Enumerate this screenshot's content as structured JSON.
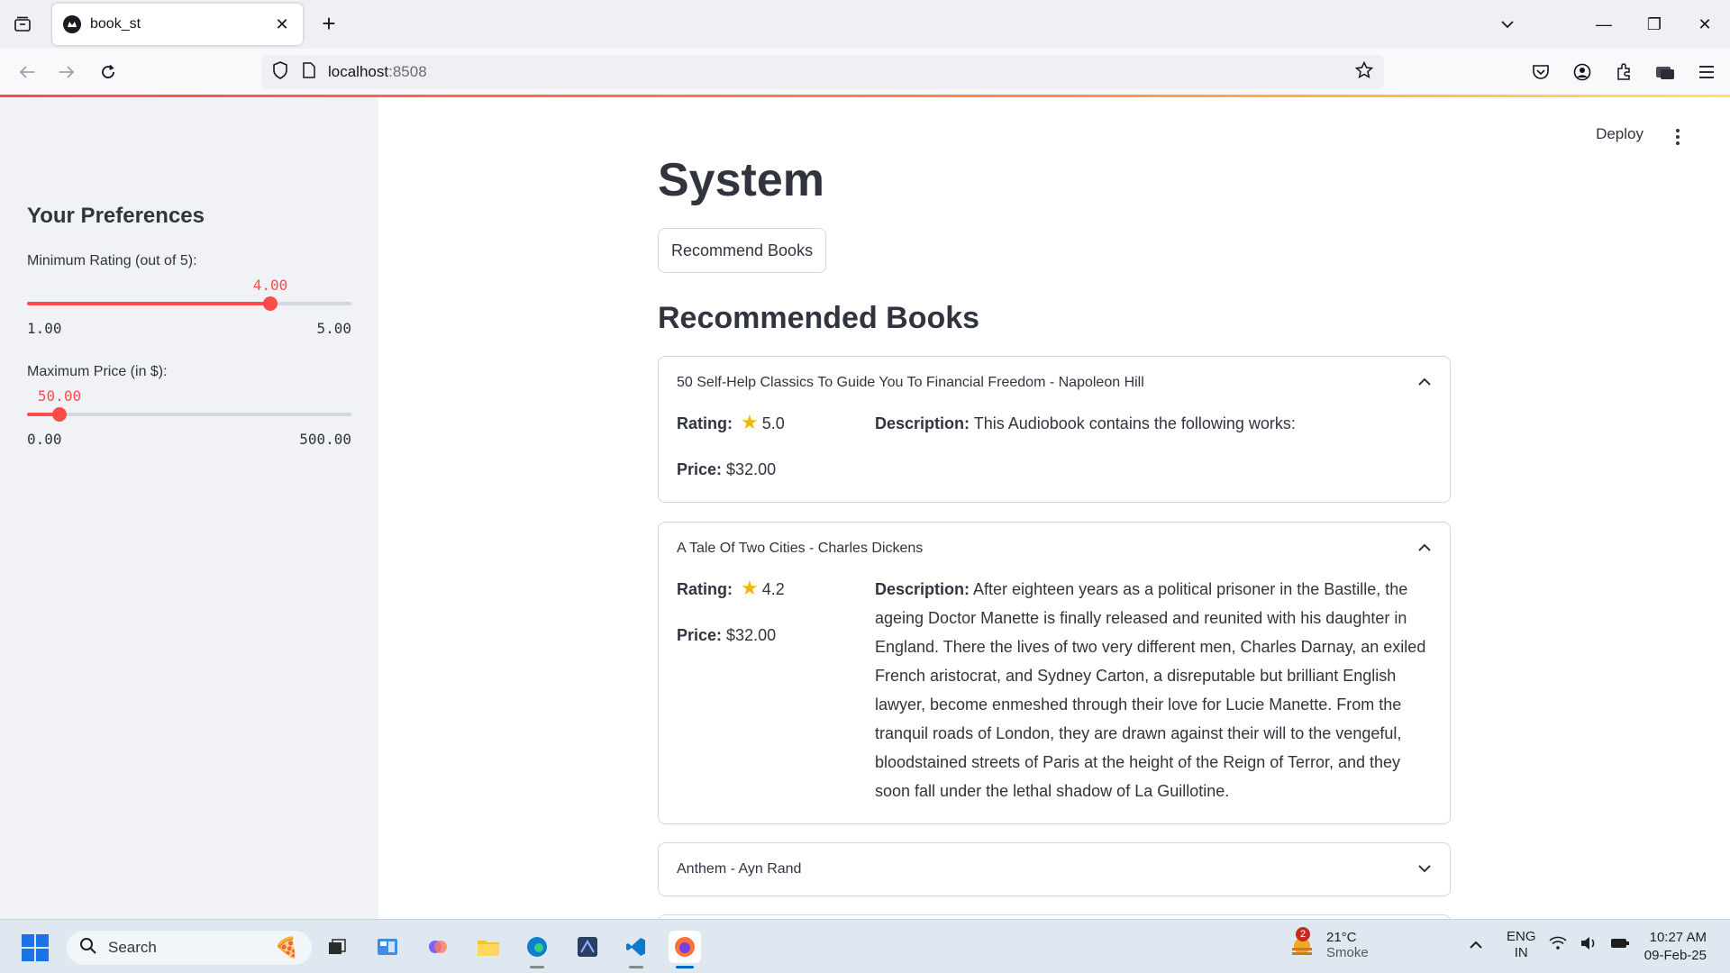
{
  "browser": {
    "tab_title": "book_st",
    "url_host": "localhost",
    "url_port": ":8508"
  },
  "app": {
    "deploy_label": "Deploy",
    "page_title": "System",
    "recommend_button": "Recommend Books",
    "section_title": "Recommended Books"
  },
  "sidebar": {
    "heading": "Your Preferences",
    "rating_slider": {
      "label": "Minimum Rating (out of 5):",
      "value": "4.00",
      "min": "1.00",
      "max": "5.00",
      "value_num": 4.0,
      "min_num": 1.0,
      "max_num": 5.0
    },
    "price_slider": {
      "label": "Maximum Price (in $):",
      "value": "50.00",
      "min": "0.00",
      "max": "500.00",
      "value_num": 50.0,
      "min_num": 0.0,
      "max_num": 500.0
    }
  },
  "books": [
    {
      "header": "50 Self-Help Classics To Guide You To Financial Freedom - Napoleon Hill",
      "expanded": true,
      "rating_label": "Rating:",
      "rating": "5.0",
      "price_label": "Price:",
      "price": "$32.00",
      "desc_label": "Description:",
      "description": "This Audiobook contains the following works:"
    },
    {
      "header": "A Tale Of Two Cities - Charles Dickens",
      "expanded": true,
      "rating_label": "Rating:",
      "rating": "4.2",
      "price_label": "Price:",
      "price": "$32.00",
      "desc_label": "Description:",
      "description": "After eighteen years as a political prisoner in the Bastille, the ageing Doctor Manette is finally released and reunited with his daughter in England. There the lives of two very different men, Charles Darnay, an exiled French aristocrat, and Sydney Carton, a disreputable but brilliant English lawyer, become enmeshed through their love for Lucie Manette. From the tranquil roads of London, they are drawn against their will to the vengeful, bloodstained streets of Paris at the height of the Reign of Terror, and they soon fall under the lethal shadow of La Guillotine."
    },
    {
      "header": "Anthem - Ayn Rand",
      "expanded": false
    }
  ],
  "taskbar": {
    "search_placeholder": "Search",
    "weather_temp": "21°C",
    "weather_cond": "Smoke",
    "weather_badge": "2",
    "lang_top": "ENG",
    "lang_bottom": "IN",
    "time": "10:27 AM",
    "date": "09-Feb-25"
  },
  "colors": {
    "accent": "#ff4b4b",
    "sidebar_bg": "#f0f2f6",
    "text": "#31333f",
    "star": "#f2b807"
  }
}
